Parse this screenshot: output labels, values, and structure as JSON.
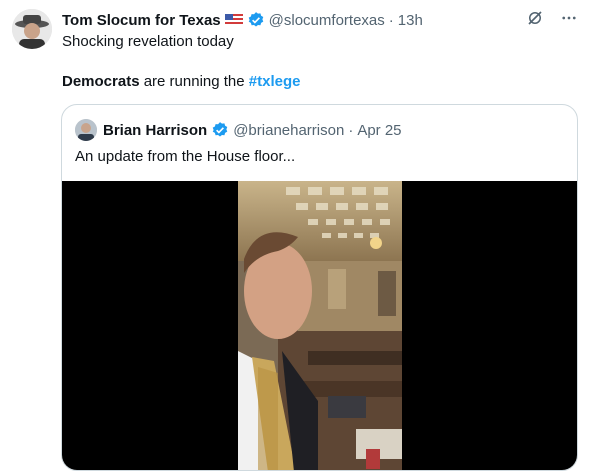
{
  "tweet": {
    "display_name": "Tom Slocum for Texas",
    "flag_icon": "us-flag-icon",
    "handle": "@slocumfortexas",
    "separator": "·",
    "time": "13h",
    "text_line1": "Shocking revelation today",
    "text_line2_bold": "Democrats",
    "text_line2_mid": " are running the ",
    "text_line2_hashtag": "#txlege"
  },
  "actions": {
    "grok_icon": "grok-icon",
    "more_label": "···"
  },
  "quoted": {
    "display_name": "Brian Harrison",
    "handle": "@brianeharrison",
    "separator": "·",
    "date": "Apr 25",
    "text": "An update from the House floor..."
  },
  "colors": {
    "accent": "#1d9bf0",
    "muted": "#536471",
    "border": "#cfd9de"
  }
}
